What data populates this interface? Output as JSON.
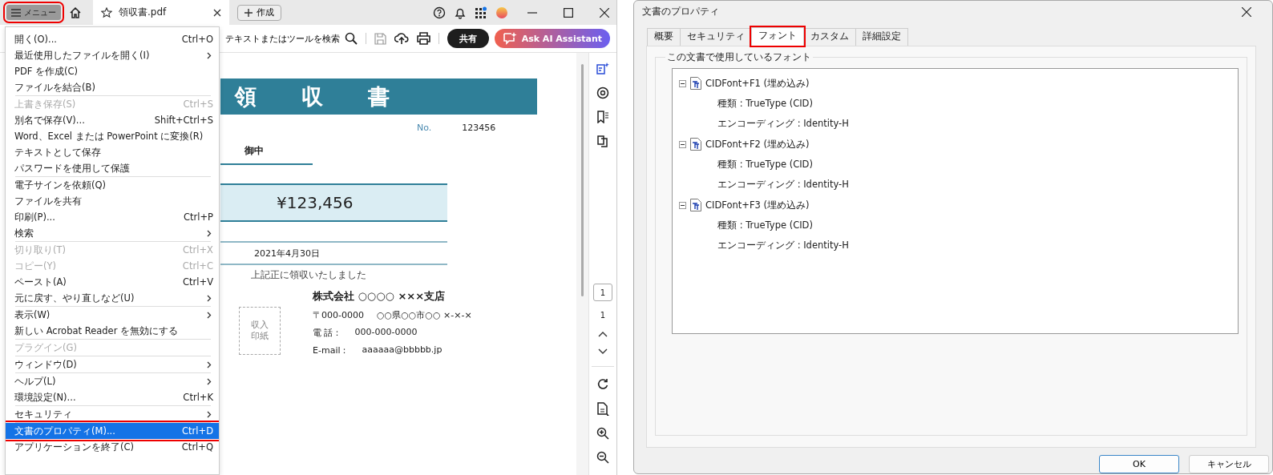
{
  "viewer": {
    "menu_button": {
      "label": "メニュー",
      "highlighted": true
    },
    "tab": {
      "label": "領収書.pdf"
    },
    "create_button": {
      "label": "作成"
    },
    "search_button": {
      "label": "テキストまたはツールを検索"
    },
    "share_button": {
      "label": "共有"
    },
    "ai_button": {
      "label": "Ask AI Assistant"
    },
    "menu": {
      "groups": [
        {
          "items": [
            {
              "label": "開く(O)...",
              "shortcut": "Ctrl+O",
              "submenu": false,
              "disabled": false,
              "selected": false,
              "highlighted": false
            },
            {
              "label": "最近使用したファイルを開く(I)",
              "submenu": true,
              "disabled": false,
              "selected": false,
              "highlighted": false
            },
            {
              "label": "PDF を作成(C)",
              "submenu": false,
              "disabled": false,
              "selected": false,
              "highlighted": false
            },
            {
              "label": "ファイルを結合(B)",
              "submenu": false,
              "disabled": false,
              "selected": false,
              "highlighted": false
            }
          ]
        },
        {
          "items": [
            {
              "label": "上書き保存(S)",
              "shortcut": "Ctrl+S",
              "submenu": false,
              "disabled": true,
              "selected": false,
              "highlighted": false
            },
            {
              "label": "別名で保存(V)...",
              "shortcut": "Shift+Ctrl+S",
              "submenu": false,
              "disabled": false,
              "selected": false,
              "highlighted": false
            },
            {
              "label": "Word、Excel または PowerPoint に変換(R)",
              "submenu": false,
              "disabled": false,
              "selected": false,
              "highlighted": false
            },
            {
              "label": "テキストとして保存",
              "submenu": false,
              "disabled": false,
              "selected": false,
              "highlighted": false
            },
            {
              "label": "パスワードを使用して保護",
              "submenu": false,
              "disabled": false,
              "selected": false,
              "highlighted": false
            }
          ]
        },
        {
          "items": [
            {
              "label": "電子サインを依頼(Q)",
              "submenu": false,
              "disabled": false,
              "selected": false,
              "highlighted": false
            },
            {
              "label": "ファイルを共有",
              "submenu": false,
              "disabled": false,
              "selected": false,
              "highlighted": false
            },
            {
              "label": "印刷(P)...",
              "shortcut": "Ctrl+P",
              "submenu": false,
              "disabled": false,
              "selected": false,
              "highlighted": false
            },
            {
              "label": "検索",
              "submenu": true,
              "disabled": false,
              "selected": false,
              "highlighted": false
            }
          ]
        },
        {
          "items": [
            {
              "label": "切り取り(T)",
              "shortcut": "Ctrl+X",
              "submenu": false,
              "disabled": true,
              "selected": false,
              "highlighted": false
            },
            {
              "label": "コピー(Y)",
              "shortcut": "Ctrl+C",
              "submenu": false,
              "disabled": true,
              "selected": false,
              "highlighted": false
            },
            {
              "label": "ペースト(A)",
              "shortcut": "Ctrl+V",
              "submenu": false,
              "disabled": false,
              "selected": false,
              "highlighted": false
            },
            {
              "label": "元に戻す、やり直しなど(U)",
              "submenu": true,
              "disabled": false,
              "selected": false,
              "highlighted": false
            }
          ]
        },
        {
          "items": [
            {
              "label": "表示(W)",
              "submenu": true,
              "disabled": false,
              "selected": false,
              "highlighted": false
            },
            {
              "label": "新しい Acrobat Reader を無効にする",
              "submenu": false,
              "disabled": false,
              "selected": false,
              "highlighted": false
            }
          ]
        },
        {
          "items": [
            {
              "label": "プラグイン(G)",
              "submenu": false,
              "disabled": true,
              "selected": false,
              "highlighted": false
            }
          ]
        },
        {
          "items": [
            {
              "label": "ウィンドウ(D)",
              "submenu": true,
              "disabled": false,
              "selected": false,
              "highlighted": false
            }
          ]
        },
        {
          "items": [
            {
              "label": "ヘルプ(L)",
              "submenu": true,
              "disabled": false,
              "selected": false,
              "highlighted": false
            },
            {
              "label": "環境設定(N)...",
              "shortcut": "Ctrl+K",
              "submenu": false,
              "disabled": false,
              "selected": false,
              "highlighted": false
            }
          ]
        },
        {
          "items": [
            {
              "label": "セキュリティ",
              "submenu": true,
              "disabled": false,
              "selected": false,
              "highlighted": false
            }
          ]
        },
        {
          "items": [
            {
              "label": "文書のプロパティ(M)...",
              "shortcut": "Ctrl+D",
              "submenu": false,
              "disabled": false,
              "selected": true,
              "highlighted": true
            },
            {
              "label": "アプリケーションを終了(C)",
              "shortcut": "Ctrl+Q",
              "submenu": false,
              "disabled": false,
              "selected": false,
              "highlighted": false
            }
          ]
        }
      ]
    },
    "document": {
      "title": "領収書",
      "number_label": "No.",
      "number": "123456",
      "recipient_suffix": "御中",
      "amount": "¥123,456",
      "date": "2021年4月30日",
      "note": "上記正に領収いたしました",
      "stamp": "収入印紙",
      "issuer": {
        "name": "株式会社 ○○○○ ×××支店",
        "postcode": "〒000-0000",
        "address": "○○県○○市○○ ×-×-×",
        "phone_label": "電 話：",
        "phone": "000-000-0000",
        "email_label": "E-mail：",
        "email": "aaaaaa@bbbbb.jp"
      }
    },
    "page_nav": {
      "current": "1",
      "total": "1"
    }
  },
  "dialog": {
    "title": "文書のプロパティ",
    "tabs": [
      {
        "label": "概要",
        "selected": false,
        "highlighted": false
      },
      {
        "label": "セキュリティ",
        "selected": false,
        "highlighted": false
      },
      {
        "label": "フォント",
        "selected": true,
        "highlighted": true
      },
      {
        "label": "カスタム",
        "selected": false,
        "highlighted": false
      },
      {
        "label": "詳細設定",
        "selected": false,
        "highlighted": false
      }
    ],
    "group_title": "この文書で使用しているフォント",
    "fonts": [
      {
        "label": "CIDFont+F1 (埋め込み)",
        "expanded": true,
        "children": [
          {
            "label": "種類 : TrueType (CID)"
          },
          {
            "label": "エンコーディング : Identity-H"
          }
        ]
      },
      {
        "label": "CIDFont+F2 (埋め込み)",
        "expanded": true,
        "children": [
          {
            "label": "種類 : TrueType (CID)"
          },
          {
            "label": "エンコーディング : Identity-H"
          }
        ]
      },
      {
        "label": "CIDFont+F3 (埋め込み)",
        "expanded": true,
        "children": [
          {
            "label": "種類 : TrueType (CID)"
          },
          {
            "label": "エンコーディング : Identity-H"
          }
        ]
      }
    ],
    "buttons": [
      {
        "label": "OK",
        "default": true
      },
      {
        "label": "キャンセル",
        "default": false
      }
    ]
  }
}
